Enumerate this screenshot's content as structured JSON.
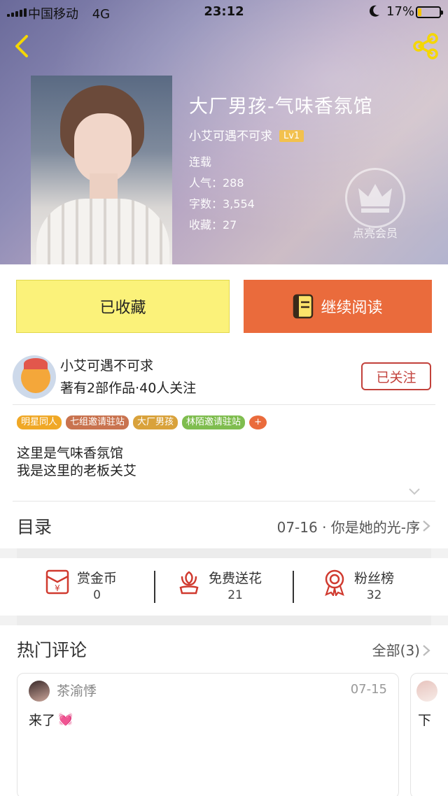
{
  "status_bar": {
    "carrier": "中国移动",
    "network": "4G",
    "time": "23:12",
    "battery": "17%",
    "battery_level": 0.17
  },
  "book": {
    "title": "大厂男孩-气味香氛馆",
    "author": "小艾可遇不可求",
    "author_level": "Lv1",
    "status": "连载",
    "popularity": "人气：288",
    "word_count": "字数：3,554",
    "favorites": "收藏：27"
  },
  "vip": {
    "label": "点亮会员"
  },
  "actions": {
    "favorite_label": "已收藏",
    "read_label": "继续阅读"
  },
  "author": {
    "name": "小艾可遇不可求",
    "stats": "著有2部作品·40人关注",
    "follow_label": "已关注"
  },
  "tags": [
    {
      "label": "明星同人",
      "color": "#f0a826"
    },
    {
      "label": "七组邀请驻站",
      "color": "#c9734f"
    },
    {
      "label": "大厂男孩",
      "color": "#d9a23b"
    },
    {
      "label": "林陌邀请驻站",
      "color": "#7fbd4f"
    },
    {
      "label": "+",
      "color": "#ea6b3c"
    }
  ],
  "intro": {
    "line1": "这里是气味香氛馆",
    "line2": "我是这里的老板关艾"
  },
  "catalog": {
    "label": "目录",
    "latest": "07-16 · 你是她的光-序"
  },
  "stats": [
    {
      "label": "赏金币",
      "value": "0",
      "icon": "red-envelope-icon"
    },
    {
      "label": "免费送花",
      "value": "21",
      "icon": "flower-icon"
    },
    {
      "label": "粉丝榜",
      "value": "32",
      "icon": "medal-icon"
    }
  ],
  "comments": {
    "title": "热门评论",
    "all_label": "全部(3)",
    "items": [
      {
        "user": "茶渝悸",
        "date": "07-15",
        "text": "来了",
        "emoji": "💓"
      },
      {
        "text": "下"
      }
    ]
  },
  "colors": {
    "accent_orange": "#ea6b3c",
    "favorite_yellow": "#fbf27a",
    "follow_red": "#c2413b",
    "badge_gold": "#f2c14e"
  }
}
